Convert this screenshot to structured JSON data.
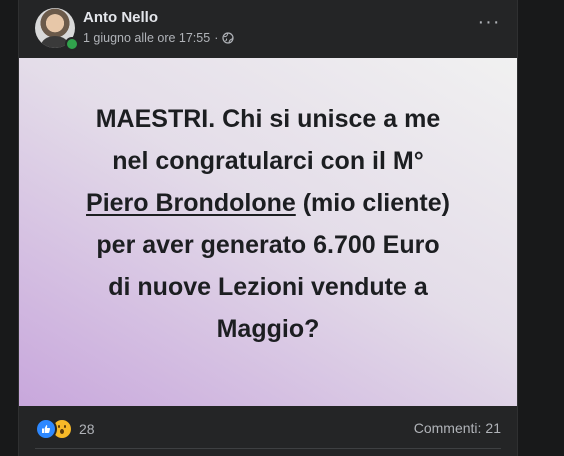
{
  "post": {
    "author": "Anto Nello",
    "timestamp": "1 giugno alle ore 17:55",
    "separator": "·",
    "privacy_icon": "globe-icon",
    "more_icon": "more-options-icon",
    "more_label": "···",
    "text": {
      "line1": "MAESTRI. Chi si unisce a me",
      "line2": "nel congratularci con il M°",
      "mention": "Piero Brondolone",
      "line3_rest": " (mio cliente)",
      "line4": "per aver generato 6.700 Euro",
      "line5": "di nuove Lezioni vendute a",
      "line6": "Maggio?"
    },
    "background_colors": [
      "#f1f1f1",
      "#e4dde9",
      "#c8a7dc"
    ]
  },
  "footer": {
    "reactions": [
      "like",
      "wow"
    ],
    "reaction_count": "28",
    "comments_label": "Commenti:",
    "comments_count": "21"
  },
  "colors": {
    "page_bg": "#18191a",
    "card_bg": "#242526",
    "text_primary": "#e4e6eb",
    "text_secondary": "#b0b3b8",
    "like_blue": "#2d88ff",
    "wow_yellow": "#f7b928",
    "online_green": "#31a24c"
  }
}
